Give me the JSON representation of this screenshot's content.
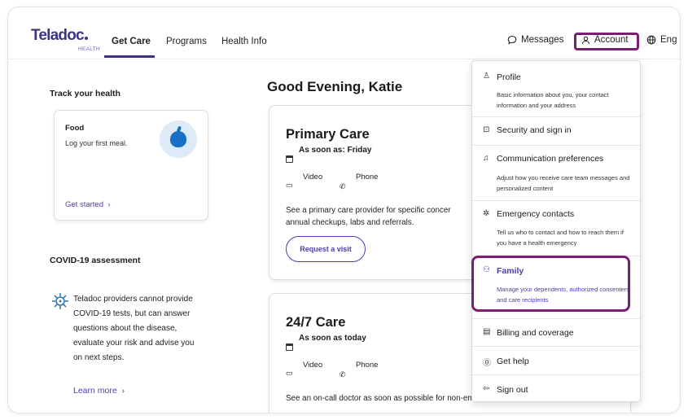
{
  "header": {
    "logo": "Teladoc",
    "logo_sub": "HEALTH",
    "nav": [
      "Get Care",
      "Programs",
      "Health Info"
    ],
    "messages": "Messages",
    "account": "Account",
    "language": "Eng"
  },
  "left": {
    "track_title": "Track your health",
    "food_title": "Food",
    "food_sub": "Log your first meal.",
    "get_started": "Get started",
    "covid_title": "COVID-19 assessment",
    "covid_text": "Teladoc providers cannot provide COVID-19 tests, but can answer questions about the disease, evaluate your risk and advise you on next steps.",
    "learn_more": "Learn more"
  },
  "main": {
    "greeting": "Good Evening, Katie",
    "cards": [
      {
        "title": "Primary Care",
        "when": "As soon as: Friday",
        "video": "Video",
        "phone": "Phone",
        "desc": "See a primary care provider for specific concer annual checkups, labs and referrals.",
        "button": "Request a visit"
      },
      {
        "title": "24/7 Care",
        "when": "As soon as today",
        "video": "Video",
        "phone": "Phone",
        "desc": "See an on-call doctor as soon as possible for non-emergency needs"
      }
    ]
  },
  "dropdown": {
    "items": [
      {
        "label": "Profile",
        "desc": "Basic information about you, your contact information and your address",
        "icon": "user-icon"
      },
      {
        "label": "Security and sign in",
        "desc": "",
        "icon": "lock-icon"
      },
      {
        "label": "Communication preferences",
        "desc": "Adjust how you receive care team messages and personalized content",
        "icon": "bell-icon"
      },
      {
        "label": "Emergency contacts",
        "desc": "Tell us who to contact and how to reach them if you have a health emergency",
        "icon": "asterisk-icon"
      },
      {
        "label": "Family",
        "desc": "Manage your dependents, authorized consenters and care recipients",
        "icon": "family-icon"
      },
      {
        "label": "Billing and coverage",
        "desc": "",
        "icon": "card-icon"
      },
      {
        "label": "Get help",
        "desc": "",
        "icon": "help-icon"
      },
      {
        "label": "Sign out",
        "desc": "",
        "icon": "sign-out-icon"
      }
    ]
  },
  "colors": {
    "brand": "#3b3580",
    "link": "#4a3db2",
    "highlight": "#7a1f6e"
  }
}
